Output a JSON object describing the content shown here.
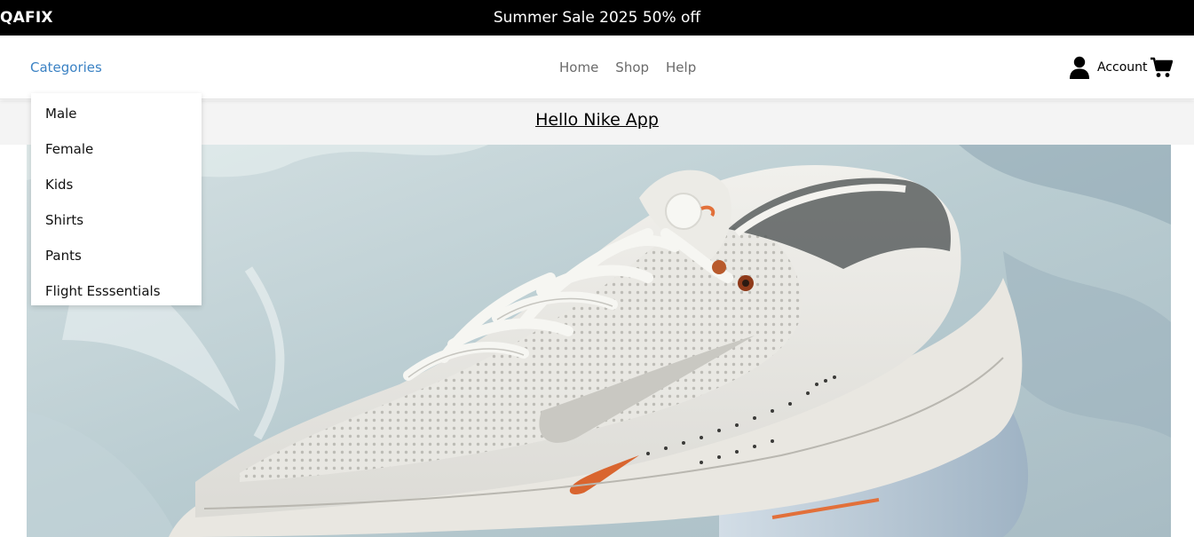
{
  "banner": {
    "brand": "QAFIX",
    "sale_text": "Summer Sale 2025 50% off"
  },
  "nav": {
    "categories_label": "Categories",
    "links": [
      {
        "label": "Home"
      },
      {
        "label": "Shop"
      },
      {
        "label": "Help"
      }
    ],
    "account_label": "Account",
    "icons": {
      "user": "user-icon",
      "cart": "shopping-cart-icon"
    }
  },
  "dropdown": {
    "items": [
      {
        "label": "Male"
      },
      {
        "label": "Female"
      },
      {
        "label": "Kids"
      },
      {
        "label": "Shirts"
      },
      {
        "label": "Pants"
      },
      {
        "label": "Flight Esssentials"
      }
    ]
  },
  "main": {
    "title": "Hello Nike App",
    "hero_image": "white-sneaker-photo"
  },
  "colors": {
    "banner_bg": "#000000",
    "accent_link": "#3b82c4",
    "nav_text": "#6b6b6b",
    "strip_bg": "#f4f4f4"
  }
}
